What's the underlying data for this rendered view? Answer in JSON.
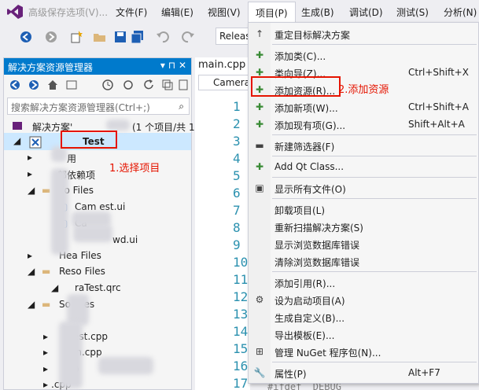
{
  "window_title": "高级保存选项(V)...",
  "menubar": [
    {
      "label": "文件(F)",
      "x": "menu-file"
    },
    {
      "label": "编辑(E)",
      "x": "menu-edit"
    },
    {
      "label": "视图(V)",
      "x": "menu-view"
    },
    {
      "label": "项目(P)",
      "x": "menu-project"
    },
    {
      "label": "生成(B)",
      "x": "menu-build"
    },
    {
      "label": "调试(D)",
      "x": "menu-debug"
    },
    {
      "label": "测试(S)",
      "x": "menu-test"
    },
    {
      "label": "分析(N)",
      "x": "menu-analyze"
    }
  ],
  "toolbar": {
    "config": "Releas"
  },
  "solution_explorer": {
    "title": "解决方案资源管理器",
    "title_icons": "▾ ⊓ ✕",
    "search_placeholder": "搜索解决方案资源管理器(Ctrl+;)",
    "solution_row": "解决方案'",
    "solution_count": "(1 个项目/共 1",
    "project_name": "Test",
    "rows": [
      {
        "label": "用"
      },
      {
        "label": "部依赖项"
      },
      {
        "label": "Fo    Files"
      },
      {
        "label": "Cam     est.ui"
      },
      {
        "label": "Ca"
      },
      {
        "label": "wd.ui"
      },
      {
        "label": "Hea    Files"
      },
      {
        "label": "Reso    Files"
      },
      {
        "label": "      raTest.qrc"
      },
      {
        "label": "So     Files"
      },
      {
        "label": "       est.cpp"
      },
      {
        "label": "      in.cpp"
      },
      {
        "label": "      p"
      },
      {
        "label": "          .cpp"
      }
    ]
  },
  "annotations": {
    "step1": "1.选择项目",
    "step2": "2.添加资源"
  },
  "editor": {
    "tab": "main.cpp",
    "nav": "Camera",
    "line_numbers": [
      "1",
      "2",
      "3",
      "4",
      "5",
      "6",
      "7",
      "8",
      "9",
      "10",
      "11",
      "12",
      "13",
      "14",
      "15",
      "16",
      "17"
    ],
    "bottom_code": "#ifdef _DEBUG"
  },
  "context_menu": {
    "items": [
      {
        "icon": "↑",
        "icon_name": "retarget-icon",
        "label": "重定目标解决方案",
        "shortcut": ""
      },
      {
        "sep": true
      },
      {
        "icon": "✚",
        "icon_name": "add-class-icon",
        "label": "添加类(C)...",
        "shortcut": ""
      },
      {
        "icon": "✚",
        "icon_name": "class-wizard-icon",
        "label": "类向导(Z)...",
        "shortcut": "Ctrl+Shift+X"
      },
      {
        "icon": "✚",
        "icon_name": "add-resource-icon",
        "label": "添加资源(R)...",
        "shortcut": ""
      },
      {
        "icon": "✚",
        "icon_name": "add-new-item-icon",
        "label": "添加新项(W)...",
        "shortcut": "Ctrl+Shift+A"
      },
      {
        "icon": "✚",
        "icon_name": "add-existing-item-icon",
        "label": "添加现有项(G)...",
        "shortcut": "Shift+Alt+A"
      },
      {
        "sep": true
      },
      {
        "icon": "▬",
        "icon_name": "new-filter-icon",
        "label": "新建筛选器(F)",
        "shortcut": ""
      },
      {
        "sep": true
      },
      {
        "icon": "✚",
        "icon_name": "add-qt-class-icon",
        "label": "Add Qt Class...",
        "shortcut": ""
      },
      {
        "sep": true
      },
      {
        "icon": "▣",
        "icon_name": "show-all-files-icon",
        "label": "显示所有文件(O)",
        "shortcut": ""
      },
      {
        "sep": true
      },
      {
        "icon": "",
        "icon_name": "unload-project-icon",
        "label": "卸载项目(L)",
        "shortcut": ""
      },
      {
        "icon": "",
        "icon_name": "rescan-icon",
        "label": "重新扫描解决方案(S)",
        "shortcut": ""
      },
      {
        "icon": "",
        "icon_name": "show-db-errors-icon",
        "label": "显示浏览数据库错误",
        "shortcut": ""
      },
      {
        "icon": "",
        "icon_name": "clear-db-errors-icon",
        "label": "清除浏览数据库错误",
        "shortcut": ""
      },
      {
        "sep": true
      },
      {
        "icon": "",
        "icon_name": "add-reference-icon",
        "label": "添加引用(R)...",
        "shortcut": ""
      },
      {
        "icon": "⚙",
        "icon_name": "gear-icon",
        "label": "设为启动项目(A)",
        "shortcut": ""
      },
      {
        "icon": "",
        "icon_name": "build-custom-icon",
        "label": "生成自定义(B)...",
        "shortcut": ""
      },
      {
        "icon": "",
        "icon_name": "export-template-icon",
        "label": "导出模板(E)...",
        "shortcut": ""
      },
      {
        "icon": "⊞",
        "icon_name": "nuget-icon",
        "label": "管理 NuGet 程序包(N)...",
        "shortcut": ""
      },
      {
        "sep": true
      },
      {
        "icon": "🔧",
        "icon_name": "wrench-icon",
        "label": "属性(P)",
        "shortcut": "Alt+F7"
      }
    ]
  },
  "colors": {
    "accent": "#007acc",
    "highlight": "#e51400",
    "selection": "#cce8ff"
  }
}
